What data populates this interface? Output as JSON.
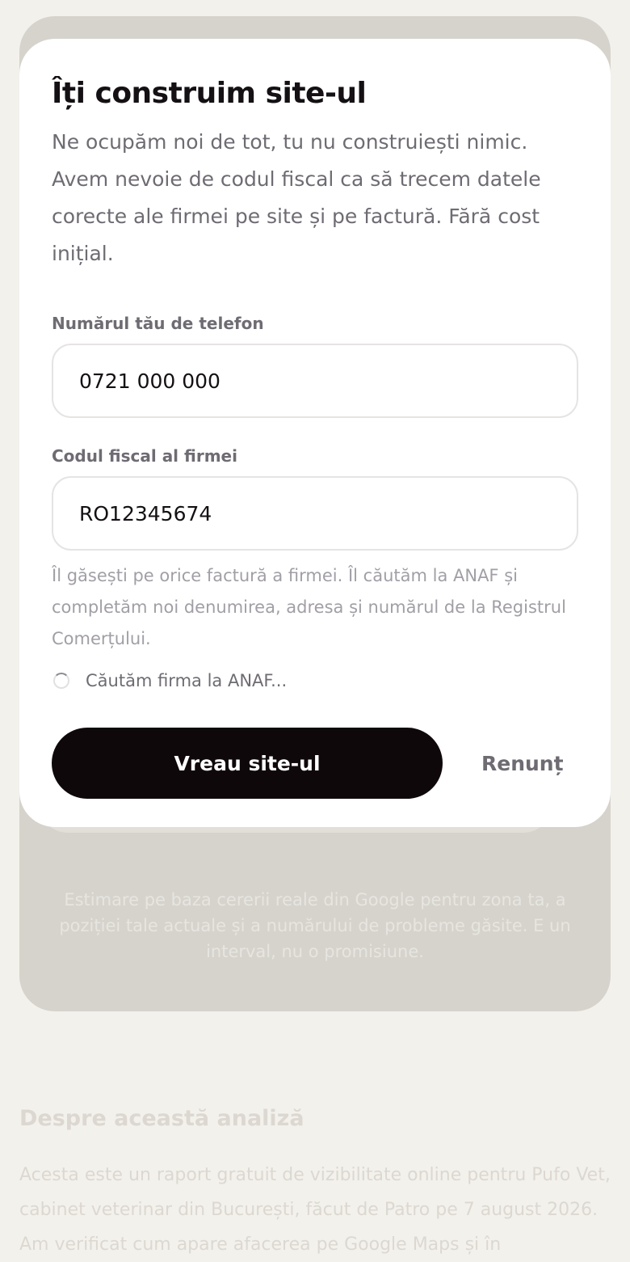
{
  "background": {
    "disclaimer": "Estimare pe baza cererii reale din Google pentru zona ta, a poziției tale actuale și a numărului de probleme găsite. E un interval, nu o promisiune.",
    "about_title": "Despre această analiză",
    "about_text": "Acesta este un raport gratuit de vizibilitate online pentru Pufo Vet, cabinet veterinar din București, făcut de Patro pe 7 august 2026. Am verificat cum apare afacerea pe Google Maps și în"
  },
  "modal": {
    "title": "Îți construim site-ul",
    "description": "Ne ocupăm noi de tot, tu nu construiești nimic. Avem nevoie de codul fiscal ca să trecem datele corecte ale firmei pe site și pe factură. Fără cost inițial.",
    "phone": {
      "label": "Numărul tău de telefon",
      "value": "0721 000 000"
    },
    "fiscal": {
      "label": "Codul fiscal al firmei",
      "value": "RO12345674",
      "hint": "Îl găsești pe orice factură a firmei. Îl căutăm la ANAF și completăm noi denumirea, adresa și numărul de la Registrul Comerțului."
    },
    "status": "Căutăm firma la ANAF...",
    "primary_label": "Vreau site-ul",
    "secondary_label": "Renunț"
  },
  "colors": {
    "page_background": "#f3f1ec",
    "primary_button": "#0f080a",
    "muted_text": "#6f6b73"
  }
}
